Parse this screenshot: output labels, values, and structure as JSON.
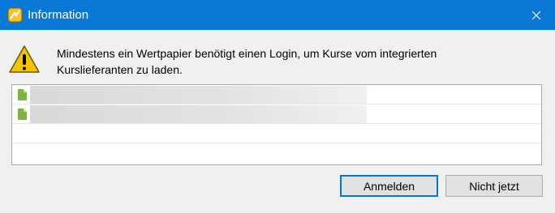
{
  "dialog": {
    "title": "Information",
    "message": "Mindestens ein Wertpapier benötigt einen Login, um Kurse vom integrierten Kurslieferanten zu laden."
  },
  "list": {
    "items": [
      {
        "icon": "green-document-icon",
        "label": ""
      },
      {
        "icon": "green-document-icon",
        "label": ""
      },
      {
        "icon": "",
        "label": ""
      },
      {
        "icon": "",
        "label": ""
      }
    ]
  },
  "buttons": {
    "login_label": "Anmelden",
    "dismiss_label": "Nicht jetzt"
  },
  "colors": {
    "titlebar": "#0a78d7",
    "accent": "#0078d7",
    "warning": "#f5c400",
    "doc_icon": "#7cb342"
  }
}
